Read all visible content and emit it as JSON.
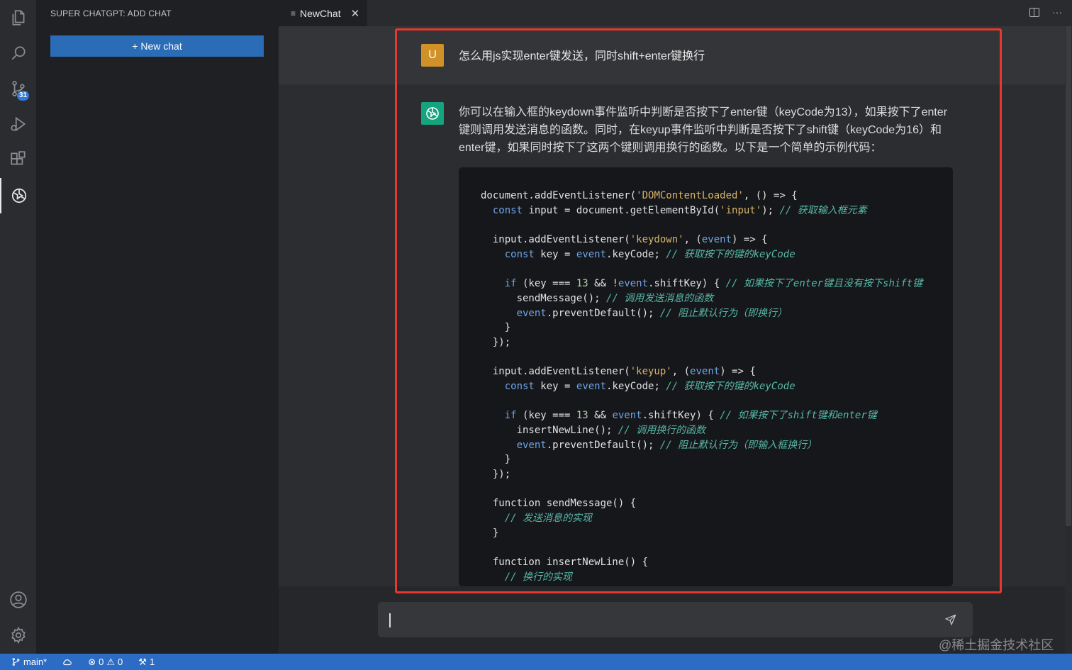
{
  "sidebar": {
    "title": "SUPER CHATGPT: ADD CHAT",
    "new_chat_label": "+ New chat"
  },
  "activity_bar": {
    "items": [
      "files-icon",
      "search-icon",
      "source-control-icon",
      "run-debug-icon",
      "extensions-icon",
      "chatgpt-icon"
    ],
    "source_control_badge": "31",
    "bottom": [
      "account-icon",
      "settings-gear-icon"
    ]
  },
  "tab": {
    "icon": "≡",
    "label": "NewChat",
    "close": "✕"
  },
  "tab_actions": {
    "more": "···"
  },
  "chat": {
    "user_avatar": "U",
    "user_message": "怎么用js实现enter键发送，同时shift+enter键换行",
    "bot_paragraph": "你可以在输入框的keydown事件监听中判断是否按下了enter键（keyCode为13），如果按下了enter键则调用发送消息的函数。同时，在keyup事件监听中判断是否按下了shift键（keyCode为16）和enter键，如果同时按下了这两个键则调用换行的函数。以下是一个简单的示例代码：",
    "code_lines": [
      [
        {
          "t": "document.addEventListener("
        },
        {
          "t": "'DOMContentLoaded'",
          "c": "str"
        },
        {
          "t": ", () => {"
        }
      ],
      [
        {
          "t": "  "
        },
        {
          "t": "const",
          "c": "kw"
        },
        {
          "t": " input = document.getElementById("
        },
        {
          "t": "'input'",
          "c": "str"
        },
        {
          "t": "); "
        },
        {
          "t": "// 获取输入框元素",
          "c": "cm"
        }
      ],
      [
        {
          "t": ""
        }
      ],
      [
        {
          "t": "  input.addEventListener("
        },
        {
          "t": "'keydown'",
          "c": "str"
        },
        {
          "t": ", ("
        },
        {
          "t": "event",
          "c": "kw"
        },
        {
          "t": ") => {"
        }
      ],
      [
        {
          "t": "    "
        },
        {
          "t": "const",
          "c": "kw"
        },
        {
          "t": " key = "
        },
        {
          "t": "event",
          "c": "kw"
        },
        {
          "t": ".keyCode; "
        },
        {
          "t": "// 获取按下的键的keyCode",
          "c": "cm"
        }
      ],
      [
        {
          "t": ""
        }
      ],
      [
        {
          "t": "    "
        },
        {
          "t": "if",
          "c": "kw"
        },
        {
          "t": " (key === "
        },
        {
          "t": "13",
          "c": "num"
        },
        {
          "t": " && !"
        },
        {
          "t": "event",
          "c": "kw"
        },
        {
          "t": ".shiftKey) { "
        },
        {
          "t": "// 如果按下了enter键且没有按下shift键",
          "c": "cm"
        }
      ],
      [
        {
          "t": "      sendMessage(); "
        },
        {
          "t": "// 调用发送消息的函数",
          "c": "cm"
        }
      ],
      [
        {
          "t": "      "
        },
        {
          "t": "event",
          "c": "kw"
        },
        {
          "t": ".preventDefault(); "
        },
        {
          "t": "// 阻止默认行为（即换行）",
          "c": "cm"
        }
      ],
      [
        {
          "t": "    }"
        }
      ],
      [
        {
          "t": "  });"
        }
      ],
      [
        {
          "t": ""
        }
      ],
      [
        {
          "t": "  input.addEventListener("
        },
        {
          "t": "'keyup'",
          "c": "str"
        },
        {
          "t": ", ("
        },
        {
          "t": "event",
          "c": "kw"
        },
        {
          "t": ") => {"
        }
      ],
      [
        {
          "t": "    "
        },
        {
          "t": "const",
          "c": "kw"
        },
        {
          "t": " key = "
        },
        {
          "t": "event",
          "c": "kw"
        },
        {
          "t": ".keyCode; "
        },
        {
          "t": "// 获取按下的键的keyCode",
          "c": "cm"
        }
      ],
      [
        {
          "t": ""
        }
      ],
      [
        {
          "t": "    "
        },
        {
          "t": "if",
          "c": "kw"
        },
        {
          "t": " (key === "
        },
        {
          "t": "13",
          "c": "num"
        },
        {
          "t": " && "
        },
        {
          "t": "event",
          "c": "kw"
        },
        {
          "t": ".shiftKey) { "
        },
        {
          "t": "// 如果按下了shift键和enter键",
          "c": "cm"
        }
      ],
      [
        {
          "t": "      insertNewLine(); "
        },
        {
          "t": "// 调用换行的函数",
          "c": "cm"
        }
      ],
      [
        {
          "t": "      "
        },
        {
          "t": "event",
          "c": "kw"
        },
        {
          "t": ".preventDefault(); "
        },
        {
          "t": "// 阻止默认行为（即输入框换行）",
          "c": "cm"
        }
      ],
      [
        {
          "t": "    }"
        }
      ],
      [
        {
          "t": "  });"
        }
      ],
      [
        {
          "t": ""
        }
      ],
      [
        {
          "t": "  function sendMessage() {"
        }
      ],
      [
        {
          "t": "    "
        },
        {
          "t": "// 发送消息的实现",
          "c": "cm"
        }
      ],
      [
        {
          "t": "  }"
        }
      ],
      [
        {
          "t": ""
        }
      ],
      [
        {
          "t": "  function insertNewLine() {"
        }
      ],
      [
        {
          "t": "    "
        },
        {
          "t": "// 换行的实现",
          "c": "cm"
        }
      ]
    ]
  },
  "input": {
    "value": "",
    "placeholder": ""
  },
  "watermark": "@稀土掘金技术社区",
  "statusbar": {
    "branch": "main*",
    "errors": "0",
    "warnings": "0",
    "ports": "1"
  },
  "colors": {
    "accent": "#2c6cc5",
    "button": "#2b6cb7",
    "user_avatar": "#d09127",
    "gpt_avatar": "#16a37f",
    "highlight": "#e8382d"
  }
}
